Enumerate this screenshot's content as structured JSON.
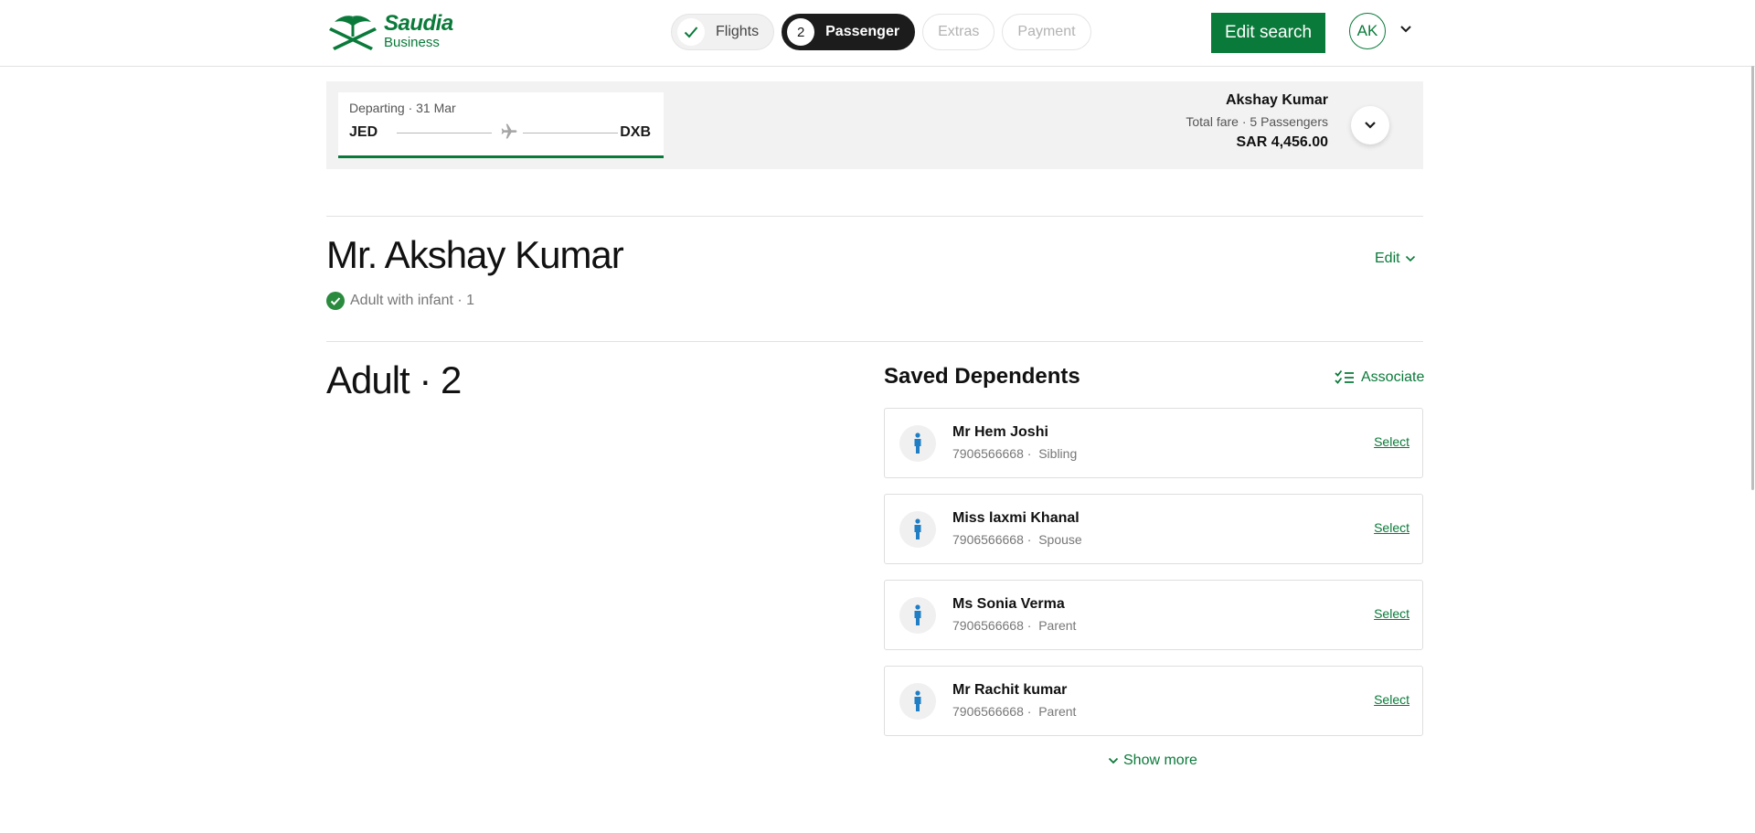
{
  "brand": {
    "name": "Saudia",
    "sub": "Business"
  },
  "steps": [
    {
      "label": "Flights",
      "state": "done"
    },
    {
      "number": "2",
      "label": "Passenger",
      "state": "active"
    },
    {
      "label": "Extras",
      "state": "disabled"
    },
    {
      "label": "Payment",
      "state": "disabled"
    }
  ],
  "header": {
    "edit_search_label": "Edit search",
    "avatar_initials": "AK"
  },
  "trip": {
    "date": "Departing · 31 Mar",
    "from": "JED",
    "to": "DXB"
  },
  "fare": {
    "name": "Akshay Kumar",
    "info": "Total fare · 5 Passengers",
    "amount": "SAR 4,456.00"
  },
  "passenger": {
    "name": "Mr. Akshay Kumar",
    "status": "Adult with infant · 1",
    "edit_label": "Edit"
  },
  "adult_section": {
    "title": "Adult · 2"
  },
  "dependents": {
    "title": "Saved Dependents",
    "associate_label": "Associate",
    "select_label": "Select",
    "show_more_label": "Show more",
    "items": [
      {
        "name": "Mr Hem Joshi",
        "phone": "7906566668 ·",
        "relation": "Sibling"
      },
      {
        "name": "Miss laxmi Khanal",
        "phone": "7906566668 ·",
        "relation": "Spouse"
      },
      {
        "name": "Ms Sonia Verma",
        "phone": "7906566668 ·",
        "relation": "Parent"
      },
      {
        "name": "Mr Rachit kumar",
        "phone": "7906566668 ·",
        "relation": "Parent"
      }
    ]
  },
  "colors": {
    "brand_green": "#0a7a3a",
    "person_icon_blue": "#1f7ec4",
    "success_green": "#2a8a3e"
  }
}
